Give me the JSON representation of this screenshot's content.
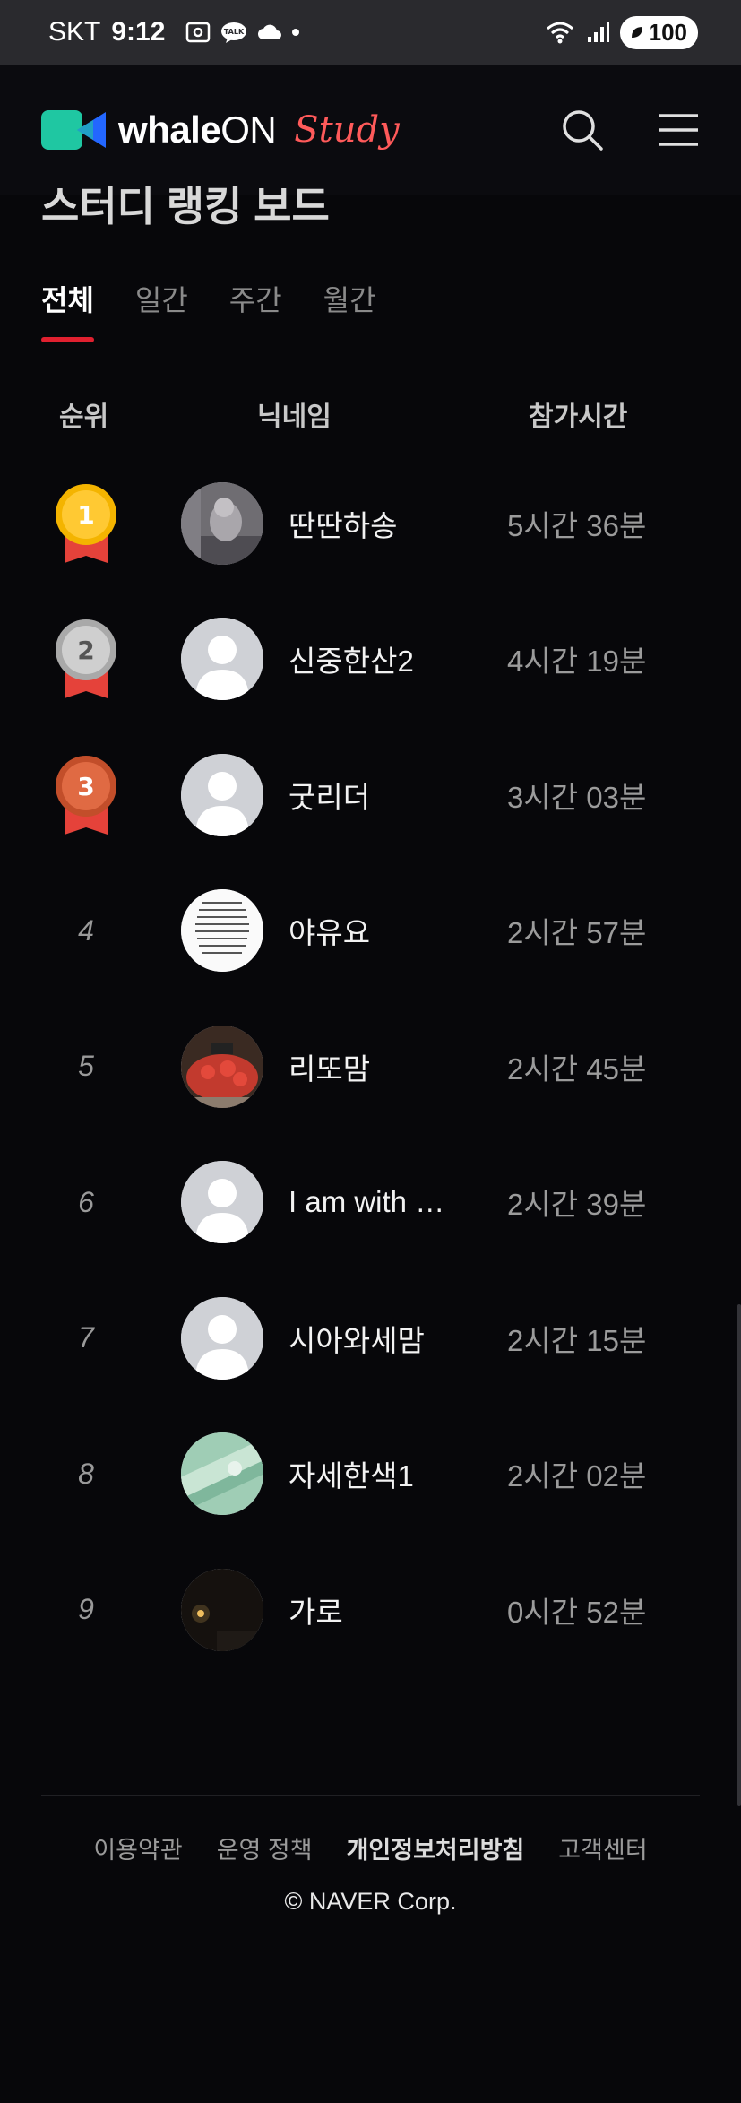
{
  "status_bar": {
    "carrier": "SKT",
    "time": "9:12",
    "battery": "100"
  },
  "app": {
    "logo_word": "whale",
    "logo_on": "ON",
    "logo_study": "Study"
  },
  "section": {
    "title": "스터디 랭킹 보드"
  },
  "tabs": [
    {
      "label": "전체",
      "active": true
    },
    {
      "label": "일간",
      "active": false
    },
    {
      "label": "주간",
      "active": false
    },
    {
      "label": "월간",
      "active": false
    }
  ],
  "table": {
    "headers": {
      "rank": "순위",
      "nickname": "닉네임",
      "time": "참가시간"
    },
    "rows": [
      {
        "rank": "1",
        "nickname": "딴딴하송",
        "time": "5시간 36분",
        "avatar": "photo-animal"
      },
      {
        "rank": "2",
        "nickname": "신중한산2",
        "time": "4시간 19분",
        "avatar": "default"
      },
      {
        "rank": "3",
        "nickname": "굿리더",
        "time": "3시간 03분",
        "avatar": "default"
      },
      {
        "rank": "4",
        "nickname": "야유요",
        "time": "2시간 57분",
        "avatar": "photo-text"
      },
      {
        "rank": "5",
        "nickname": "리또맘",
        "time": "2시간 45분",
        "avatar": "photo-cake"
      },
      {
        "rank": "6",
        "nickname": "I am with …",
        "time": "2시간 39분",
        "avatar": "default"
      },
      {
        "rank": "7",
        "nickname": "시아와세맘",
        "time": "2시간 15분",
        "avatar": "default"
      },
      {
        "rank": "8",
        "nickname": "자세한색1",
        "time": "2시간 02분",
        "avatar": "photo-money"
      },
      {
        "rank": "9",
        "nickname": "가로",
        "time": "0시간 52분",
        "avatar": "photo-night"
      }
    ]
  },
  "footer": {
    "links": [
      "이용약관",
      "운영 정책",
      "개인정보처리방침",
      "고객센터"
    ],
    "copyright": "© NAVER Corp."
  },
  "colors": {
    "accent": "#e0202f",
    "gold": "#f4b400",
    "silver": "#bdbdbd",
    "bronze": "#d9623a"
  }
}
